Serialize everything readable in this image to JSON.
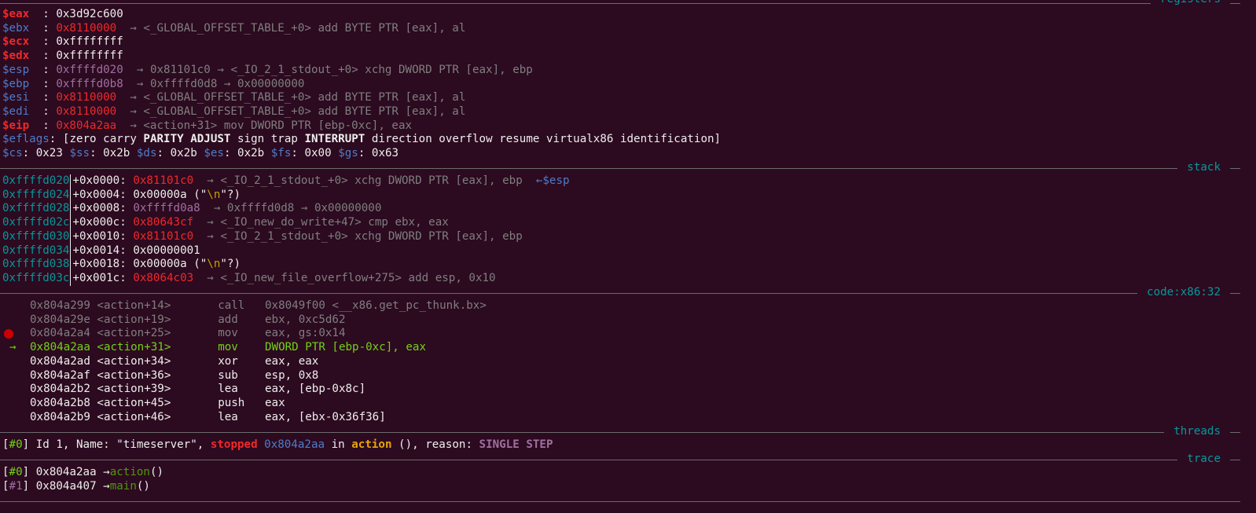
{
  "sections": {
    "registers": "registers",
    "stack": "stack",
    "code": "code:x86:32",
    "threads": "threads",
    "trace": "trace"
  },
  "registers": [
    {
      "name": "$eax",
      "style": "red",
      "value": "0x3d92c600",
      "value_style": "white",
      "rest": ""
    },
    {
      "name": "$ebx",
      "style": "blue",
      "value": "0x8110000",
      "value_style": "red",
      "rest": "→ <_GLOBAL_OFFSET_TABLE_+0> add BYTE PTR [eax], al"
    },
    {
      "name": "$ecx",
      "style": "red",
      "value": "0xffffffff",
      "value_style": "white",
      "rest": ""
    },
    {
      "name": "$edx",
      "style": "red",
      "value": "0xffffffff",
      "value_style": "white",
      "rest": ""
    },
    {
      "name": "$esp",
      "style": "blue",
      "value": "0xffffd020",
      "value_style": "purple",
      "rest": "→ 0x81101c0 → <_IO_2_1_stdout_+0> xchg DWORD PTR [eax], ebp"
    },
    {
      "name": "$ebp",
      "style": "blue",
      "value": "0xffffd0b8",
      "value_style": "purple",
      "rest": "→ 0xffffd0d8 → 0x00000000"
    },
    {
      "name": "$esi",
      "style": "blue",
      "value": "0x8110000",
      "value_style": "red",
      "rest": "→ <_GLOBAL_OFFSET_TABLE_+0> add BYTE PTR [eax], al"
    },
    {
      "name": "$edi",
      "style": "blue",
      "value": "0x8110000",
      "value_style": "red",
      "rest": "→ <_GLOBAL_OFFSET_TABLE_+0> add BYTE PTR [eax], al"
    },
    {
      "name": "$eip",
      "style": "red",
      "value": "0x804a2aa",
      "value_style": "red",
      "rest": "→ <action+31> mov DWORD PTR [ebp-0xc], eax"
    }
  ],
  "eflags": {
    "name": "$eflags",
    "open": "[",
    "flags": [
      {
        "t": "zero",
        "b": false
      },
      {
        "t": "carry",
        "b": false
      },
      {
        "t": "PARITY",
        "b": true
      },
      {
        "t": "ADJUST",
        "b": true
      },
      {
        "t": "sign",
        "b": false
      },
      {
        "t": "trap",
        "b": false
      },
      {
        "t": "INTERRUPT",
        "b": true
      },
      {
        "t": "direction",
        "b": false
      },
      {
        "t": "overflow",
        "b": false
      },
      {
        "t": "resume",
        "b": false
      },
      {
        "t": "virtualx86",
        "b": false
      },
      {
        "t": "identification",
        "b": false
      }
    ],
    "close": "]"
  },
  "segments": [
    {
      "name": "$cs",
      "value": "0x23"
    },
    {
      "name": "$ss",
      "value": "0x2b"
    },
    {
      "name": "$ds",
      "value": "0x2b"
    },
    {
      "name": "$es",
      "value": "0x2b"
    },
    {
      "name": "$fs",
      "value": "0x00"
    },
    {
      "name": "$gs",
      "value": "0x63"
    }
  ],
  "stack": [
    {
      "addr": "0xffffd020",
      "off": "+0x0000:",
      "v1": "0x81101c0",
      "v1s": "red",
      "rest": "→ <_IO_2_1_stdout_+0> xchg DWORD PTR [eax], ebp",
      "tag": "←$esp"
    },
    {
      "addr": "0xffffd024",
      "off": "+0x0004:",
      "v1": "0x00000a",
      "v1s": "white",
      "str": "\\n",
      "tag": ""
    },
    {
      "addr": "0xffffd028",
      "off": "+0x0008:",
      "v1": "0xffffd0a8",
      "v1s": "purple",
      "rest": "→ 0xffffd0d8 → 0x00000000",
      "tag": ""
    },
    {
      "addr": "0xffffd02c",
      "off": "+0x000c:",
      "v1": "0x80643cf",
      "v1s": "red",
      "rest": "→ <_IO_new_do_write+47> cmp ebx, eax",
      "tag": ""
    },
    {
      "addr": "0xffffd030",
      "off": "+0x0010:",
      "v1": "0x81101c0",
      "v1s": "red",
      "rest": "→ <_IO_2_1_stdout_+0> xchg DWORD PTR [eax], ebp",
      "tag": ""
    },
    {
      "addr": "0xffffd034",
      "off": "+0x0014:",
      "v1": "0x00000001",
      "v1s": "white",
      "rest": "",
      "tag": ""
    },
    {
      "addr": "0xffffd038",
      "off": "+0x0018:",
      "v1": "0x00000a",
      "v1s": "white",
      "str": "\\n",
      "tag": ""
    },
    {
      "addr": "0xffffd03c",
      "off": "+0x001c:",
      "v1": "0x8064c03",
      "v1s": "red",
      "rest": "→ <_IO_new_file_overflow+275> add esp, 0x10",
      "tag": ""
    }
  ],
  "code": [
    {
      "addr": "0x804a299",
      "sym": "<action+14>",
      "op": "call",
      "args": "0x8049f00 <__x86.get_pc_thunk.bx>",
      "state": "past"
    },
    {
      "addr": "0x804a29e",
      "sym": "<action+19>",
      "op": "add",
      "args": "ebx, 0xc5d62",
      "state": "past"
    },
    {
      "addr": "0x804a2a4",
      "sym": "<action+25>",
      "op": "mov",
      "args": "eax, gs:0x14",
      "state": "past",
      "breakpoint": true
    },
    {
      "addr": "0x804a2aa",
      "sym": "<action+31>",
      "op": "mov",
      "args": "DWORD PTR [ebp-0xc], eax",
      "state": "cur"
    },
    {
      "addr": "0x804a2ad",
      "sym": "<action+34>",
      "op": "xor",
      "args": "eax, eax",
      "state": "fut"
    },
    {
      "addr": "0x804a2af",
      "sym": "<action+36>",
      "op": "sub",
      "args": "esp, 0x8",
      "state": "fut"
    },
    {
      "addr": "0x804a2b2",
      "sym": "<action+39>",
      "op": "lea",
      "args": "eax, [ebp-0x8c]",
      "state": "fut"
    },
    {
      "addr": "0x804a2b8",
      "sym": "<action+45>",
      "op": "push",
      "args": "eax",
      "state": "fut"
    },
    {
      "addr": "0x804a2b9",
      "sym": "<action+46>",
      "op": "lea",
      "args": "eax, [ebx-0x36f36]",
      "state": "fut"
    }
  ],
  "current_arrow": "→",
  "thread": {
    "id": "#0",
    "desc": "Id 1, Name: \"timeserver\",",
    "state": "stopped",
    "addr": "0x804a2aa",
    "in": "in",
    "func": "action",
    "tail": "(), reason:",
    "reason": "SINGLE STEP"
  },
  "trace": [
    {
      "id": "#0",
      "addr": "0x804a2aa",
      "func": "action",
      "tail": "()"
    },
    {
      "id": "#1",
      "addr": "0x804a407",
      "func": "main",
      "tail": "()"
    }
  ],
  "colors": {
    "background": "#2c0a20",
    "register_red": "#ef2929",
    "register_blue": "#4f7cc8",
    "section_title": "#06989a",
    "current_line": "#73d216"
  }
}
